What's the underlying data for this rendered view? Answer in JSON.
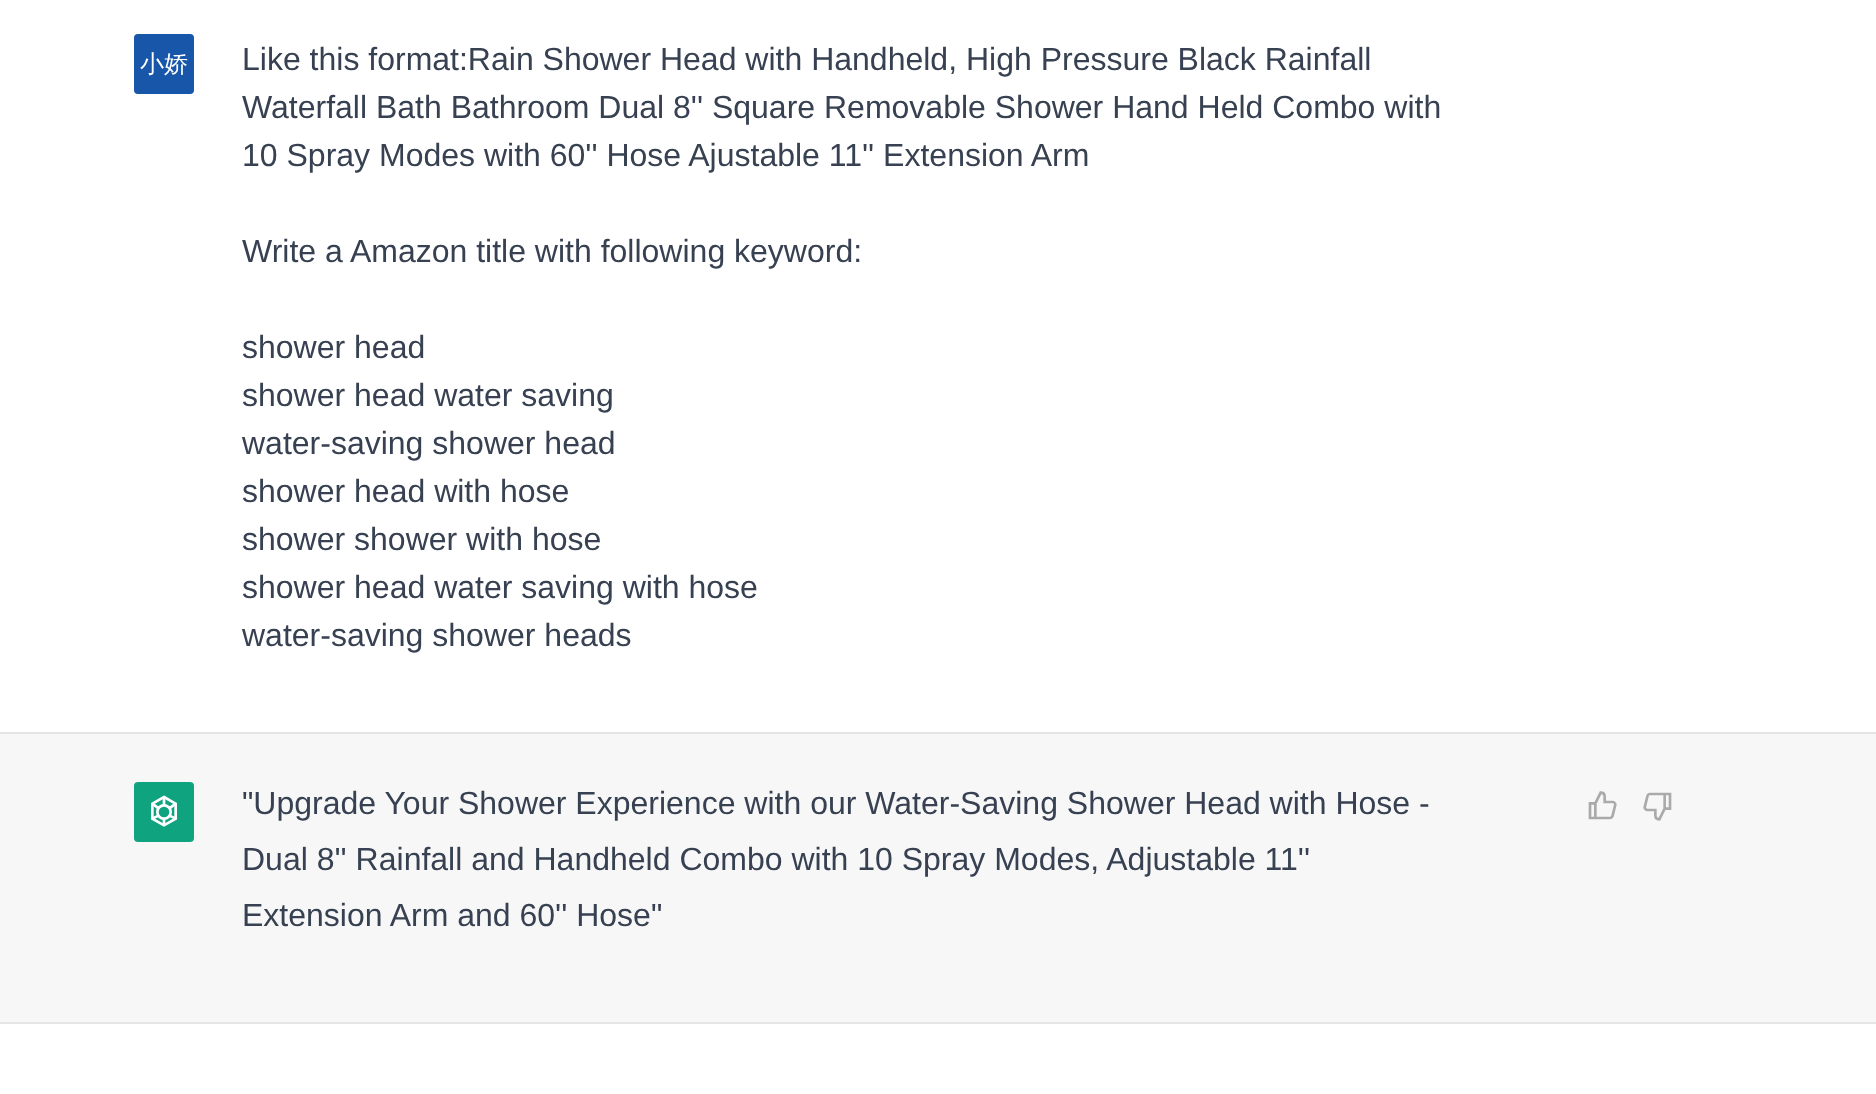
{
  "messages": [
    {
      "kind": "user",
      "avatar": "小娇",
      "paragraphs": [
        "Like this format:Rain Shower Head with Handheld, High Pressure Black Rainfall Waterfall Bath Bathroom Dual 8'' Square Removable Shower Hand Held Combo with 10 Spray Modes with 60'' Hose Ajustable 11'' Extension Arm",
        "Write a Amazon title with following keyword:",
        "shower head\nshower head water saving\nwater-saving shower head\nshower head with hose\nshower shower with hose\nshower head water saving with hose\nwater-saving shower heads"
      ]
    },
    {
      "kind": "assistant",
      "paragraphs": [
        "\"Upgrade Your Shower Experience with our Water-Saving Shower Head with Hose - Dual 8'' Rainfall and Handheld Combo with 10 Spray Modes, Adjustable 11'' Extension Arm and 60'' Hose\""
      ]
    }
  ]
}
